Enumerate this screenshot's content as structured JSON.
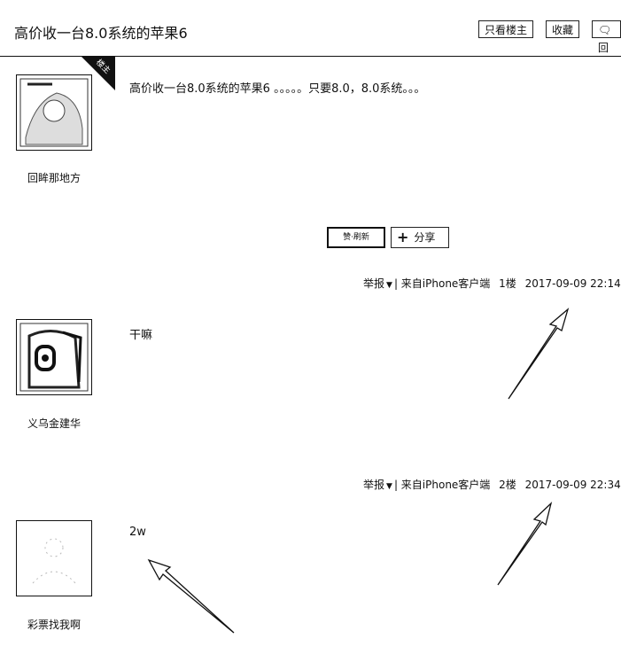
{
  "header": {
    "title": "高价收一台8.0系统的苹果6",
    "buttons": {
      "only_op": "只看楼主",
      "favorite": "收藏",
      "reply": "回"
    }
  },
  "op_tag": "楼主",
  "posts": [
    {
      "username": "回眸那地方",
      "text": "高价收一台8.0系统的苹果6 。。。。。只要8.0，8.0系统。。。"
    },
    {
      "username": "义乌金建华",
      "text": "干嘛"
    },
    {
      "username": "彩票找我啊",
      "text": "2w"
    }
  ],
  "actions": {
    "like_label": "赞·刷新",
    "share_label": "分享"
  },
  "meta": [
    {
      "report": "举报",
      "source": "| 来自iPhone客户端",
      "floor": "1楼",
      "time": "2017-09-09 22:14",
      "trail": "|"
    },
    {
      "report": "举报",
      "source": "| 来自iPhone客户端",
      "floor": "2楼",
      "time": "2017-09-09 22:34",
      "trail": "|"
    }
  ],
  "icons": [
    "caret-down-icon",
    "plus-icon",
    "comment-icon"
  ]
}
